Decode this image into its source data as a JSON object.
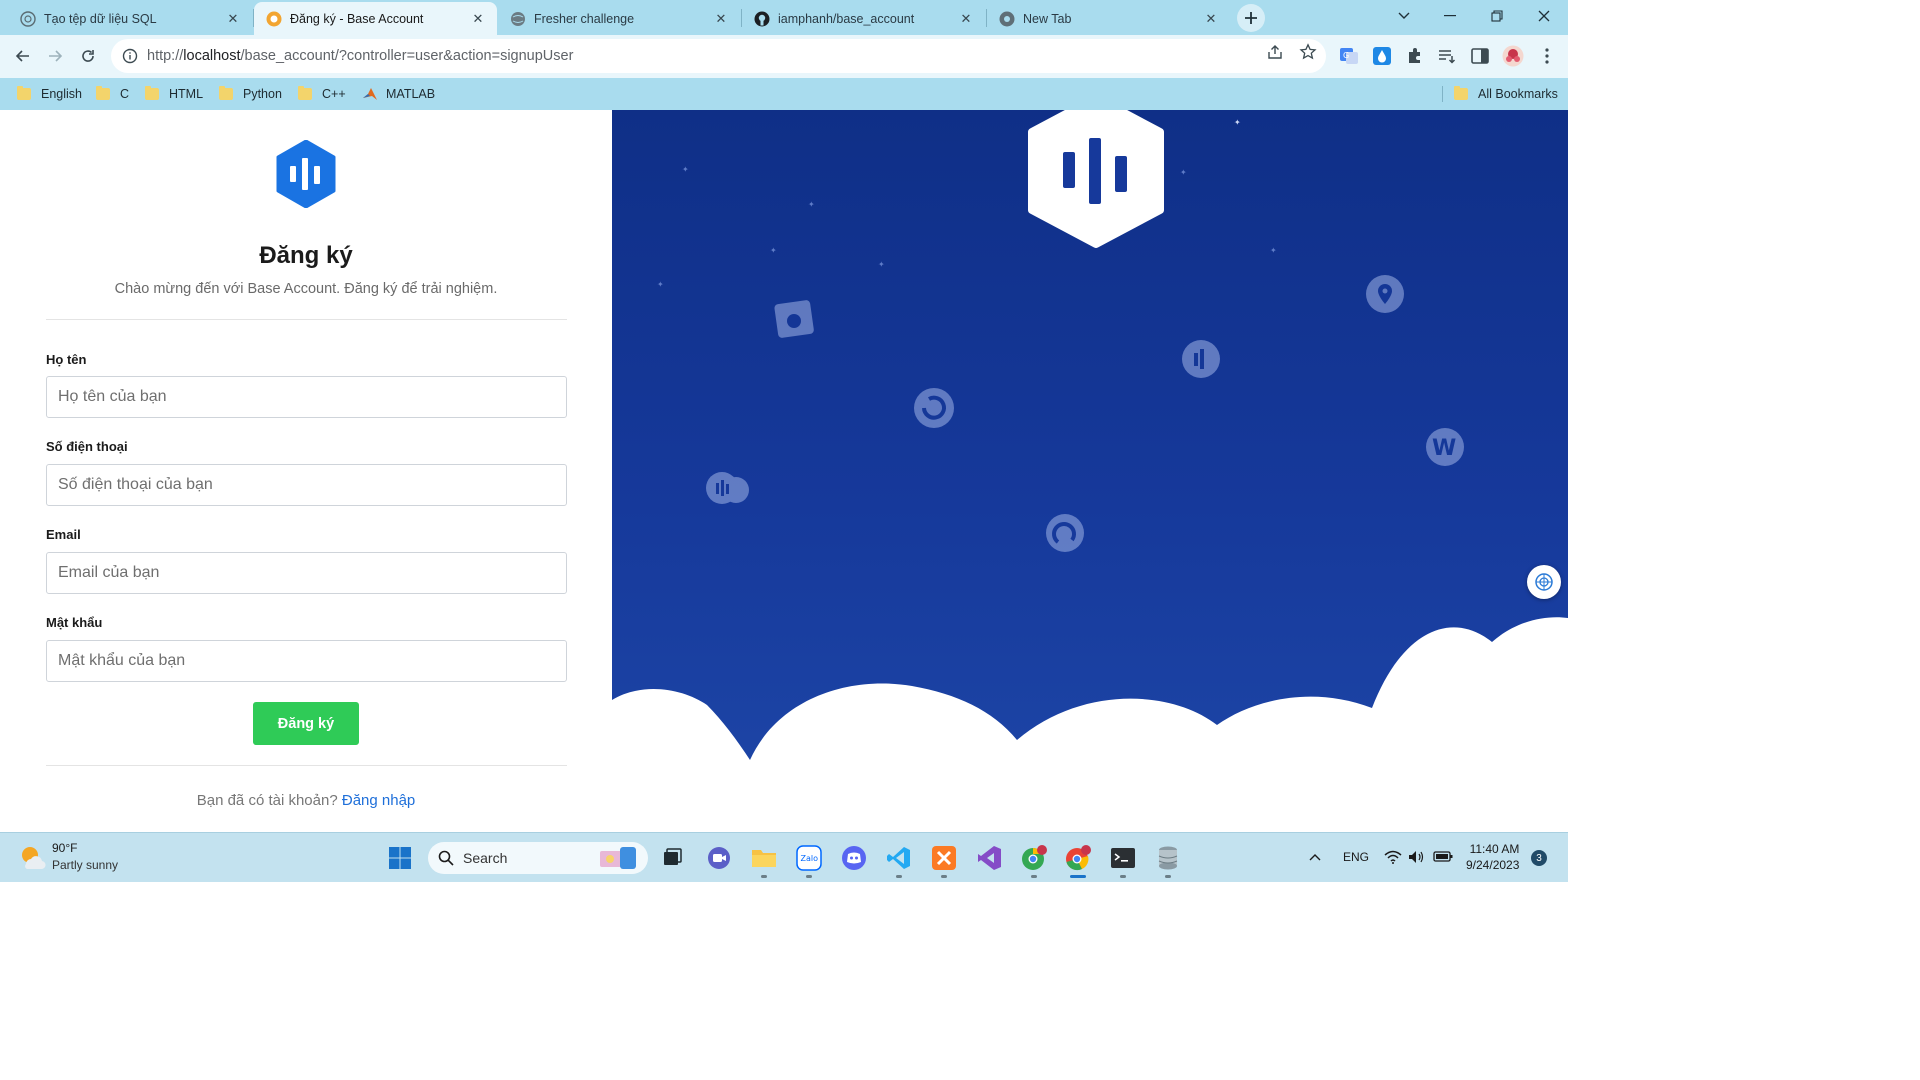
{
  "browser": {
    "tabs": [
      {
        "title": "Tạo tệp dữ liệu SQL",
        "icon": "chatgpt-icon"
      },
      {
        "title": "Đăng ký - Base Account",
        "icon": "base-icon",
        "active": true
      },
      {
        "title": "Fresher challenge",
        "icon": "globe-icon"
      },
      {
        "title": "iamphanh/base_account",
        "icon": "github-icon"
      },
      {
        "title": "New Tab",
        "icon": "chrome-icon"
      }
    ],
    "url": {
      "prefix": "http://",
      "host": "localhost",
      "path": "/base_account/?controller=user&action=signupUser"
    },
    "bookmarks": [
      "English",
      "C",
      "HTML",
      "Python",
      "C++",
      "MATLAB"
    ],
    "all_bookmarks": "All Bookmarks"
  },
  "form": {
    "title": "Đăng ký",
    "subtitle": "Chào mừng đến với Base Account. Đăng ký để trải nghiệm.",
    "fields": [
      {
        "label": "Họ tên",
        "placeholder": "Họ tên của bạn"
      },
      {
        "label": "Số điện thoại",
        "placeholder": "Số điện thoại của bạn"
      },
      {
        "label": "Email",
        "placeholder": "Email của bạn"
      },
      {
        "label": "Mật khẩu",
        "placeholder": "Mật khẩu của bạn"
      }
    ],
    "submit_label": "Đăng ký",
    "footer_text": "Bạn đã có tài khoản?",
    "login_link": "Đăng nhập"
  },
  "colors": {
    "accent": "#1e6fd9",
    "submit": "#2fcb57",
    "hero_bg": "#16399b"
  },
  "taskbar": {
    "weather": {
      "temp": "90°F",
      "desc": "Partly sunny"
    },
    "search_label": "Search",
    "lang": "ENG",
    "time": "11:40 AM",
    "date": "9/24/2023",
    "notifications": "3"
  }
}
